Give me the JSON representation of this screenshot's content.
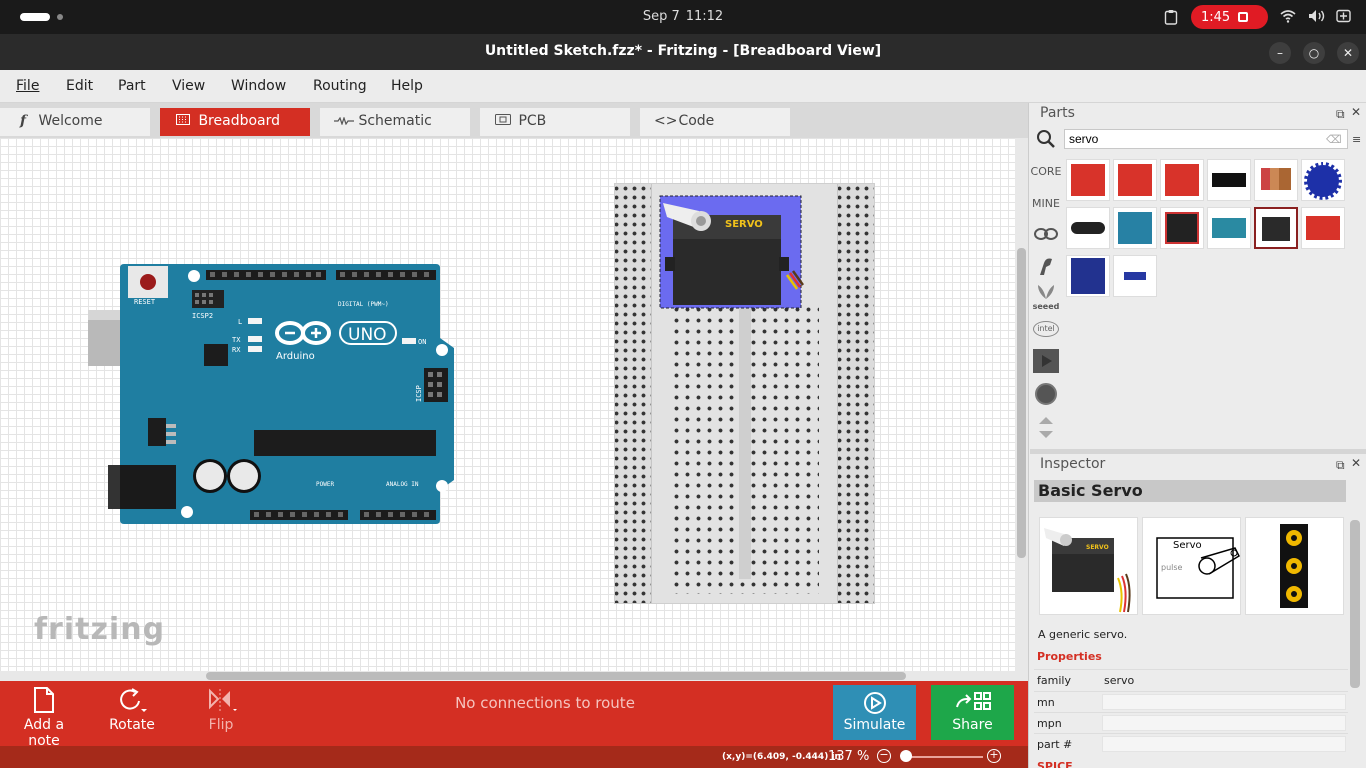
{
  "system_bar": {
    "date": "Sep 7",
    "time": "11:12",
    "recording_time": "1:45",
    "icons": [
      "clipboard-icon",
      "wifi-icon",
      "volume-icon",
      "battery-icon"
    ]
  },
  "window": {
    "title": "Untitled Sketch.fzz* - Fritzing - [Breadboard View]",
    "controls": [
      "minimize",
      "maximize",
      "close"
    ]
  },
  "menu": [
    "File",
    "Edit",
    "Part",
    "View",
    "Window",
    "Routing",
    "Help"
  ],
  "tabs": [
    {
      "label": "Welcome",
      "icon": "fritzing-f-icon",
      "active": false
    },
    {
      "label": "Breadboard",
      "icon": "breadboard-icon",
      "active": true
    },
    {
      "label": "Schematic",
      "icon": "resistor-icon",
      "active": false
    },
    {
      "label": "PCB",
      "icon": "pcb-icon",
      "active": false
    },
    {
      "label": "Code",
      "icon": "code-icon",
      "active": false
    }
  ],
  "canvas": {
    "watermark": "fritzing",
    "arduino": {
      "reset_label": "RESET",
      "icsp2_label": "ICSP2",
      "brand": "Arduino",
      "model": "UNO",
      "digital_label": "DIGITAL (PWM~)",
      "analog_label": "ANALOG IN",
      "power_label": "POWER",
      "led_labels": [
        "L",
        "TX",
        "RX",
        "ON"
      ],
      "icsp_label": "ICSP"
    },
    "servo_label": "SERVO"
  },
  "toolbar": {
    "add_note": "Add a note",
    "rotate": "Rotate",
    "flip": "Flip",
    "routing_status": "No connections to route",
    "simulate": "Simulate",
    "share": "Share",
    "colors": {
      "toolbar": "#d42f23",
      "simulate": "#2f8fb5",
      "share": "#1ea74a"
    }
  },
  "status": {
    "coords": "(x,y)=(6.409, -0.444) in",
    "zoom": "137 %"
  },
  "parts": {
    "title": "Parts",
    "search_value": "servo",
    "bins": [
      "CORE",
      "MINE"
    ],
    "bin_icons": [
      "arduino-bin-icon",
      "contrib-bin-icon",
      "seeed-bin-icon",
      "intel-bin-icon",
      "media-bin-icon",
      "snootlab-bin-icon",
      "arrows-bin-icon"
    ],
    "seeed_label": "seeed",
    "intel_label": "intel"
  },
  "inspector": {
    "title": "Inspector",
    "part_name": "Basic Servo",
    "schematic_label": "Servo",
    "schematic_pin": "pulse",
    "description": "A generic servo.",
    "properties_heading": "Properties",
    "properties": [
      {
        "key": "family",
        "value": "servo"
      },
      {
        "key": "mn",
        "value": ""
      },
      {
        "key": "mpn",
        "value": ""
      },
      {
        "key": "part #",
        "value": ""
      }
    ],
    "spice_heading": "SPICE"
  }
}
